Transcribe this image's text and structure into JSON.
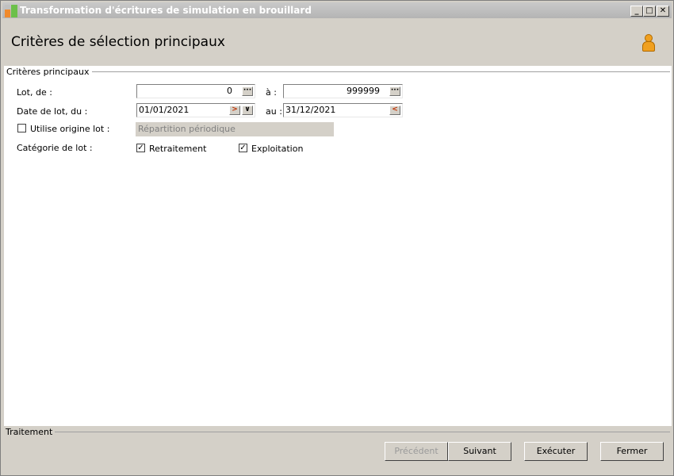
{
  "window": {
    "title": "Transformation d'écritures de simulation en brouillard"
  },
  "header": {
    "title": "Critères de sélection principaux"
  },
  "section": {
    "label": "Critères principaux"
  },
  "lot": {
    "label": "Lot, de :",
    "from": "0",
    "to_label": "à :",
    "to": "999999"
  },
  "date": {
    "label": "Date de lot, du :",
    "from": "01/01/2021",
    "to_label": "au :",
    "to": "31/12/2021"
  },
  "origin": {
    "label": "Utilise origine lot :",
    "checked": false,
    "value": "Répartition périodique"
  },
  "category": {
    "label": "Catégorie de lot :",
    "options": [
      {
        "label": "Retraitement",
        "checked": true
      },
      {
        "label": "Exploitation",
        "checked": true
      }
    ]
  },
  "footer": {
    "section_label": "Traitement",
    "buttons": {
      "previous": "Précédent",
      "next": "Suivant",
      "execute": "Exécuter",
      "close": "Fermer"
    }
  }
}
